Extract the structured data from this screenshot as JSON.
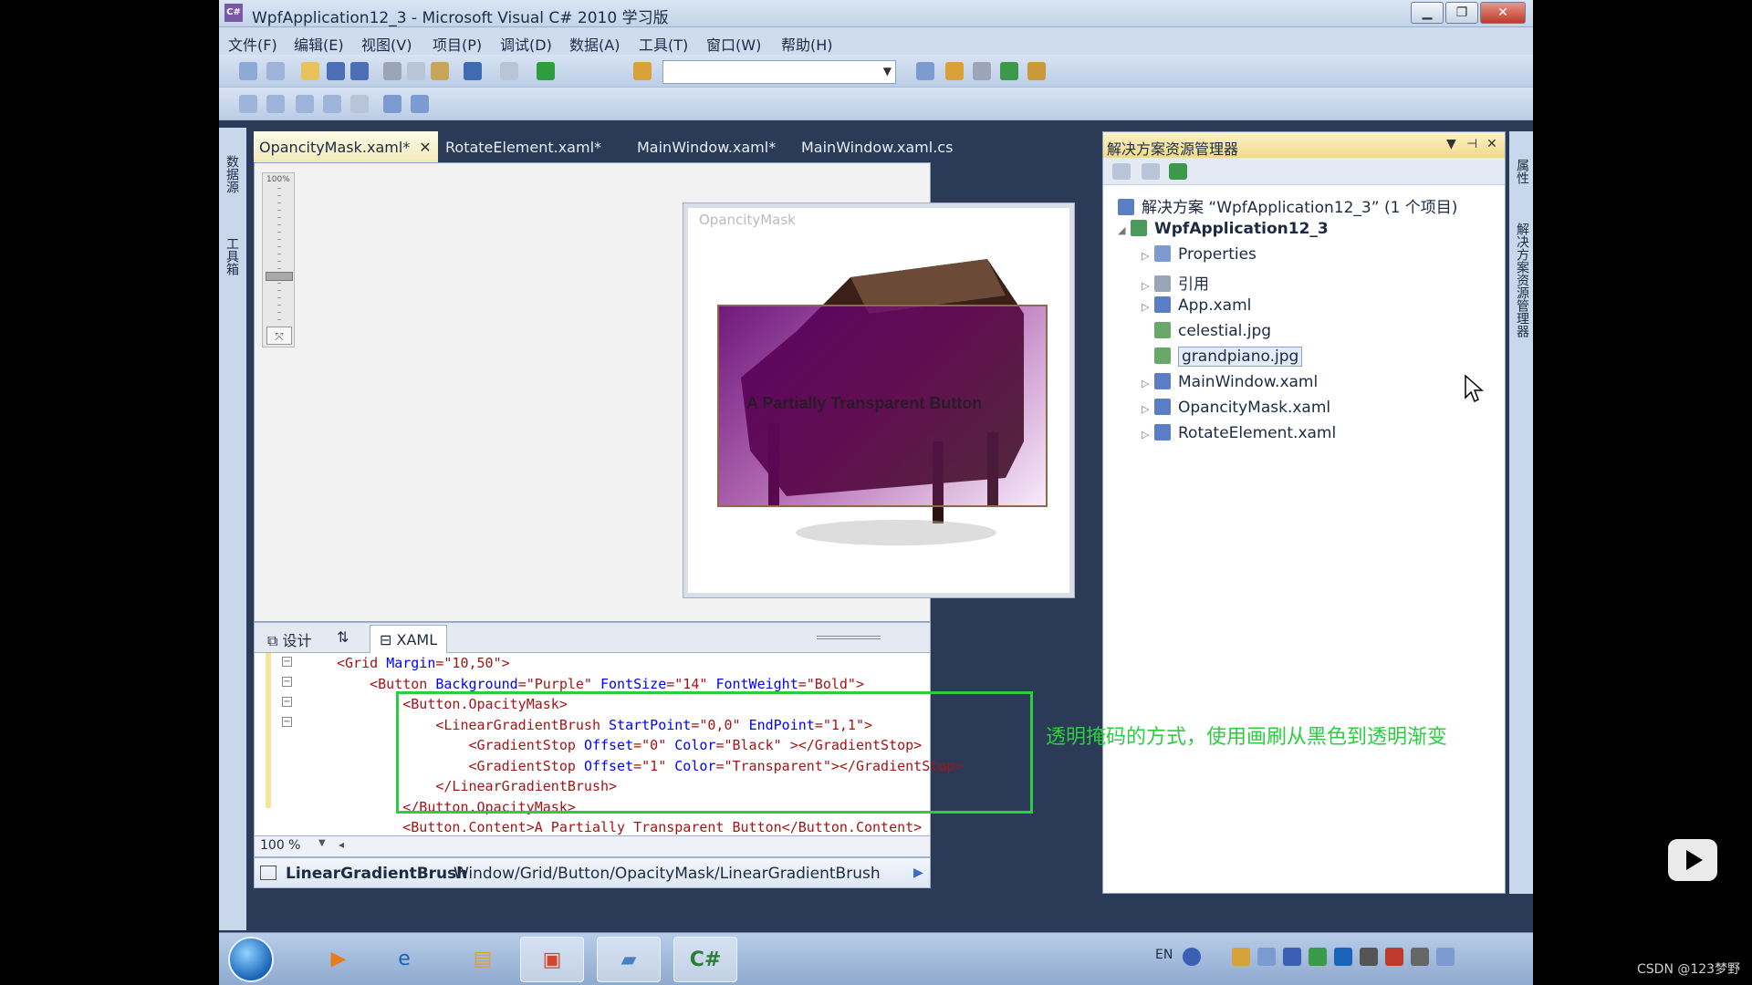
{
  "window": {
    "title": "WpfApplication12_3 - Microsoft Visual C# 2010 学习版"
  },
  "menu": [
    "文件(F)",
    "编辑(E)",
    "视图(V)",
    "项目(P)",
    "调试(D)",
    "数据(A)",
    "工具(T)",
    "窗口(W)",
    "帮助(H)"
  ],
  "left_panel": {
    "data_sources": "数据源",
    "toolbox": "工具箱"
  },
  "right_panel": {
    "properties": "属性",
    "solution_explorer": "解决方案资源管理器"
  },
  "doc_tabs": [
    "OpancityMask.xaml*",
    "RotateElement.xaml*",
    "MainWindow.xaml*",
    "MainWindow.xaml.cs"
  ],
  "designer": {
    "zoom_label": "100%",
    "window_title": "OpancityMask",
    "button_text": "A Partially Transparent Button"
  },
  "split": {
    "design_tab": "设计",
    "swap_label": "⇅",
    "xaml_tab": "XAML"
  },
  "code": [
    {
      "indent": "",
      "parts": [
        "<Grid ",
        "Margin",
        "=\"10,50\">"
      ]
    },
    {
      "indent": "    ",
      "parts": [
        "<Button ",
        "Background",
        "=\"Purple\" ",
        "FontSize",
        "=\"14\" ",
        "FontWeight",
        "=\"Bold\">"
      ]
    },
    {
      "indent": "        ",
      "parts": [
        "<Button.OpacityMask>"
      ]
    },
    {
      "indent": "            ",
      "parts": [
        "<LinearGradientBrush ",
        "StartPoint",
        "=\"0,0\" ",
        "EndPoint",
        "=\"1,1\">"
      ]
    },
    {
      "indent": "                ",
      "parts": [
        "<GradientStop ",
        "Offset",
        "=\"0\" ",
        "Color",
        "=\"Black\" ></GradientStop>"
      ]
    },
    {
      "indent": "                ",
      "parts": [
        "<GradientStop ",
        "Offset",
        "=\"1\" ",
        "Color",
        "=\"Transparent\"></GradientStop>"
      ]
    },
    {
      "indent": "            ",
      "parts": [
        "</LinearGradientBrush>"
      ]
    },
    {
      "indent": "        ",
      "parts": [
        "</Button.OpacityMask>"
      ]
    },
    {
      "indent": "        ",
      "parts": [
        "<Button.Content>A Partially Transparent Button</Button.Content>"
      ]
    }
  ],
  "annotation": "透明掩码的方式，使用画刷从黑色到透明渐变",
  "zoom": {
    "value": "100 %"
  },
  "status": {
    "element": "LinearGradientBrush",
    "path": "Window/Grid/Button/OpacityMask/LinearGradientBrush"
  },
  "solution": {
    "title": "解决方案资源管理器",
    "root": "解决方案 “WpfApplication12_3” (1 个项目)",
    "project": "WpfApplication12_3",
    "items": [
      "Properties",
      "引用",
      "App.xaml",
      "celestial.jpg",
      "grandpiano.jpg",
      "MainWindow.xaml",
      "OpancityMask.xaml",
      "RotateElement.xaml"
    ]
  },
  "taskbar": {
    "lang": "EN"
  },
  "watermark": "CSDN @123梦野",
  "colors": {
    "highlight": "#2ecc40",
    "button_bg": "Purple"
  }
}
